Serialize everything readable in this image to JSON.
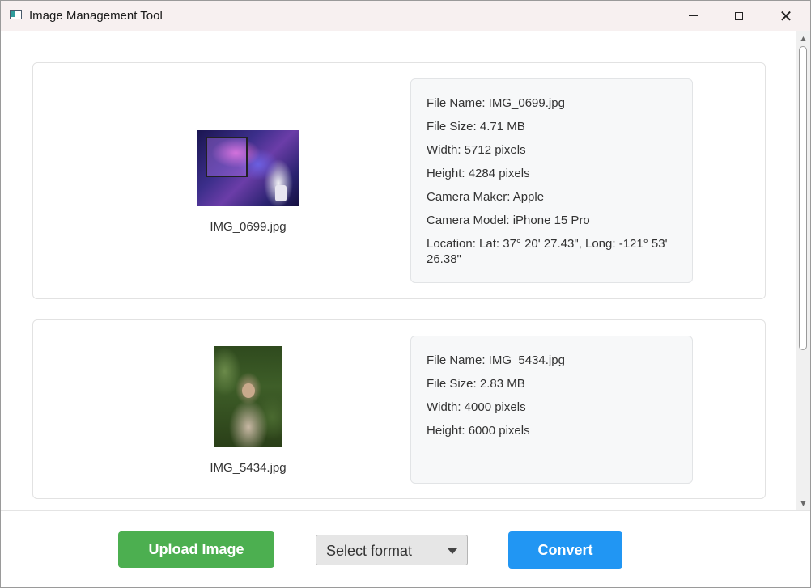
{
  "window": {
    "title": "Image Management Tool"
  },
  "images": [
    {
      "caption": "IMG_0699.jpg",
      "details": [
        "File Name: IMG_0699.jpg",
        "File Size: 4.71 MB",
        "Width: 5712 pixels",
        "Height: 4284 pixels",
        "Camera Maker: Apple",
        "Camera Model: iPhone 15 Pro",
        "Location: Lat: 37° 20' 27.43\", Long: -121° 53' 26.38\""
      ]
    },
    {
      "caption": "IMG_5434.jpg",
      "details": [
        "File Name: IMG_5434.jpg",
        "File Size: 2.83 MB",
        "Width: 4000 pixels",
        "Height: 6000 pixels"
      ]
    }
  ],
  "footer": {
    "upload_label": "Upload Image",
    "format_select": "Select format",
    "convert_label": "Convert"
  },
  "colors": {
    "upload_button": "#4caf50",
    "convert_button": "#2196f3",
    "titlebar": "#f7f0f0"
  },
  "icons": {
    "app": "app-window-icon",
    "minimize": "minimize-icon",
    "maximize": "maximize-icon",
    "close": "close-icon",
    "dropdown": "chevron-down-icon"
  }
}
